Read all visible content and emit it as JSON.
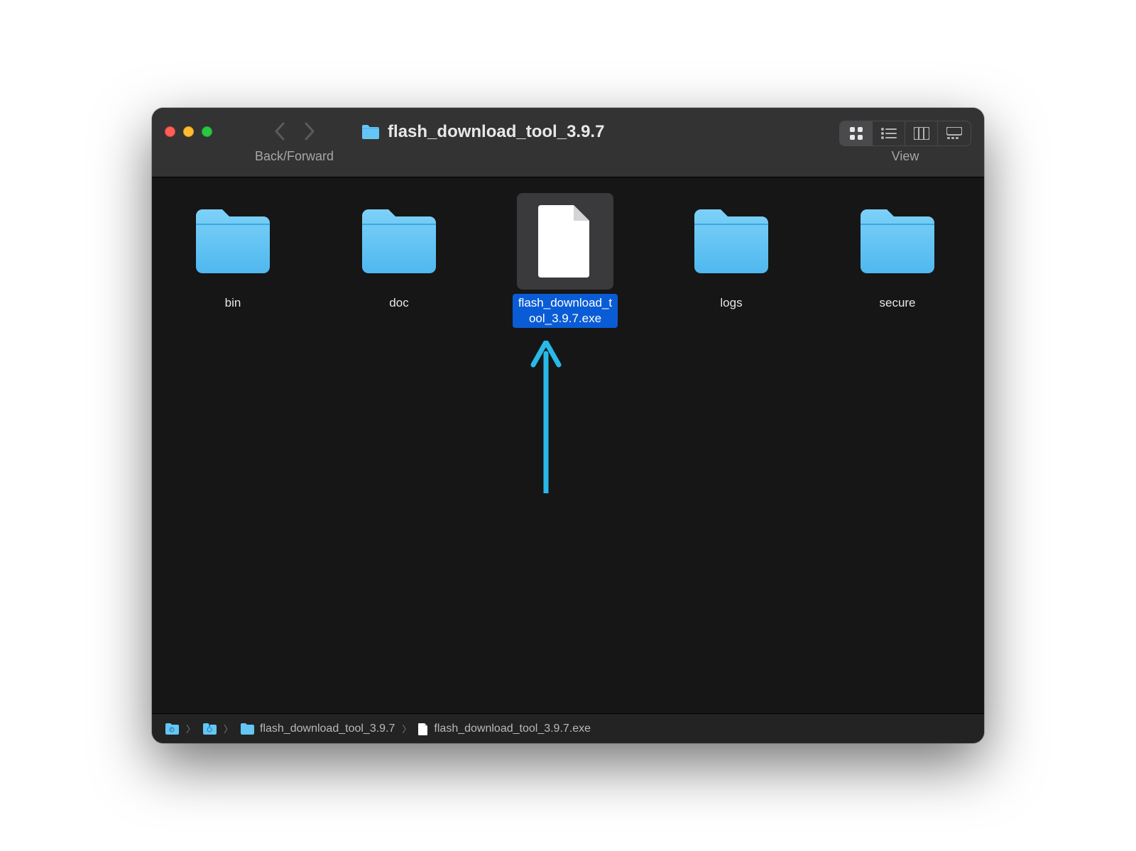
{
  "toolbar": {
    "back_forward_label": "Back/Forward",
    "view_label": "View",
    "title": "flash_download_tool_3.9.7"
  },
  "items": [
    {
      "name": "bin",
      "type": "folder",
      "selected": false
    },
    {
      "name": "doc",
      "type": "folder",
      "selected": false
    },
    {
      "name": "flash_download_tool_3.9.7.exe",
      "type": "file",
      "selected": true
    },
    {
      "name": "logs",
      "type": "folder",
      "selected": false
    },
    {
      "name": "secure",
      "type": "folder",
      "selected": false
    }
  ],
  "pathbar": {
    "crumbs": [
      {
        "type": "home",
        "label": ""
      },
      {
        "type": "folder",
        "label": ""
      },
      {
        "type": "folder",
        "label": "flash_download_tool_3.9.7"
      },
      {
        "type": "file",
        "label": "flash_download_tool_3.9.7.exe"
      }
    ]
  },
  "colors": {
    "folder": "#65c6f5",
    "selection": "#0a5cd6",
    "arrow": "#28b9e9"
  }
}
